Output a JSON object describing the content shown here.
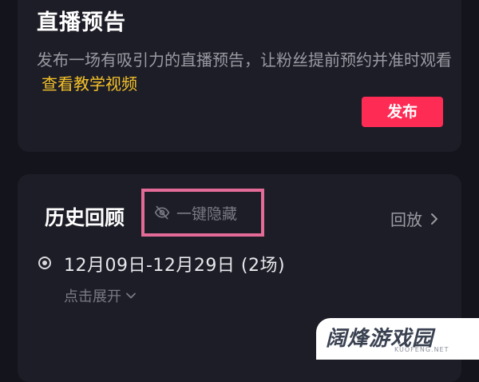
{
  "preview_card": {
    "title": "直播预告",
    "description": "发布一场有吸引力的直播预告，让粉丝提前预约并准时观看",
    "tutorial_link": "查看教学视频",
    "publish_label": "发布"
  },
  "history": {
    "title": "历史回顾",
    "hide_label": "一键隐藏",
    "replay_label": "回放",
    "entry": {
      "date_range": "12月09日-12月29日 (2场)",
      "expand_label": "点击展开"
    }
  },
  "watermark": {
    "text": "阔烽游戏园",
    "subtext": "KUOFENG.NET"
  },
  "colors": {
    "background": "#14141d",
    "card": "#1d1d27",
    "publish_button": "#fe2c55",
    "link": "#f5c22a",
    "highlight_box": "#e46b98"
  }
}
